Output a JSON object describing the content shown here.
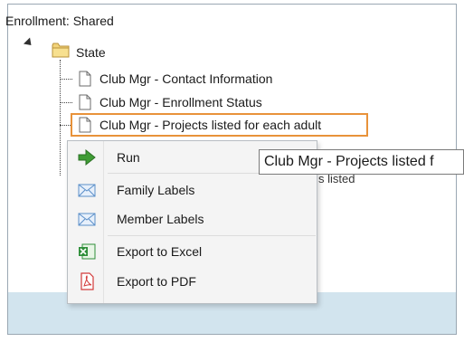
{
  "panel": {
    "title": "Enrollment: Shared"
  },
  "tree": {
    "folder": {
      "label": "State",
      "icon": "folder-icon"
    },
    "reports": [
      {
        "label": "Club Mgr - Contact Information"
      },
      {
        "label": "Club Mgr - Enrollment Status"
      },
      {
        "label": "Club Mgr - Projects listed for each adult",
        "selected": true
      }
    ],
    "obscured_label_fragment": "s listed"
  },
  "context_menu": {
    "items": [
      {
        "label": "Run",
        "icon": "run-arrow-icon"
      },
      {
        "label": "Family Labels",
        "icon": "envelope-icon"
      },
      {
        "label": "Member Labels",
        "icon": "envelope-icon"
      },
      {
        "label": "Export to Excel",
        "icon": "excel-icon"
      },
      {
        "label": "Export to PDF",
        "icon": "pdf-icon"
      }
    ]
  },
  "tooltip": {
    "text": "Club Mgr - Projects listed f"
  },
  "colors": {
    "selection_border": "#e8923a",
    "bottom_strip": "#d2e4ee",
    "run_arrow": "#3f9c35",
    "envelope": "#5b8fc9",
    "excel": "#2f8f3a",
    "pdf": "#d23b3b"
  }
}
